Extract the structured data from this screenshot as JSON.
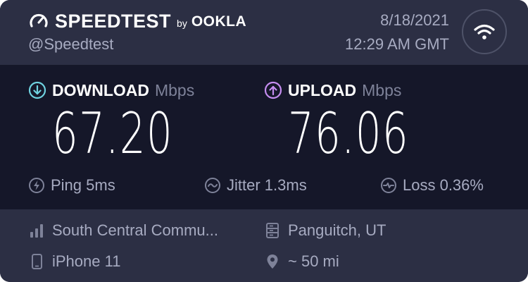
{
  "header": {
    "brand": "SPEEDTEST",
    "brand_by": "by",
    "brand_ookla": "OOKLA",
    "handle": "@Speedtest",
    "date": "8/18/2021",
    "time": "12:29 AM GMT"
  },
  "results": {
    "download": {
      "label": "DOWNLOAD",
      "unit": "Mbps",
      "value": "67.20",
      "icon": "download-arrow-icon",
      "color": "#6fd2e0"
    },
    "upload": {
      "label": "UPLOAD",
      "unit": "Mbps",
      "value": "76.06",
      "icon": "upload-arrow-icon",
      "color": "#c58df0"
    },
    "ping": "Ping 5ms",
    "jitter": "Jitter 1.3ms",
    "loss": "Loss 0.36%"
  },
  "details": {
    "provider": "South Central Commu...",
    "server": "Panguitch, UT",
    "device": "iPhone 11",
    "distance": "~ 50 mi"
  },
  "colors": {
    "panel": "#2c2f44",
    "results_bg": "#151729",
    "muted_text": "#a7abc1"
  }
}
